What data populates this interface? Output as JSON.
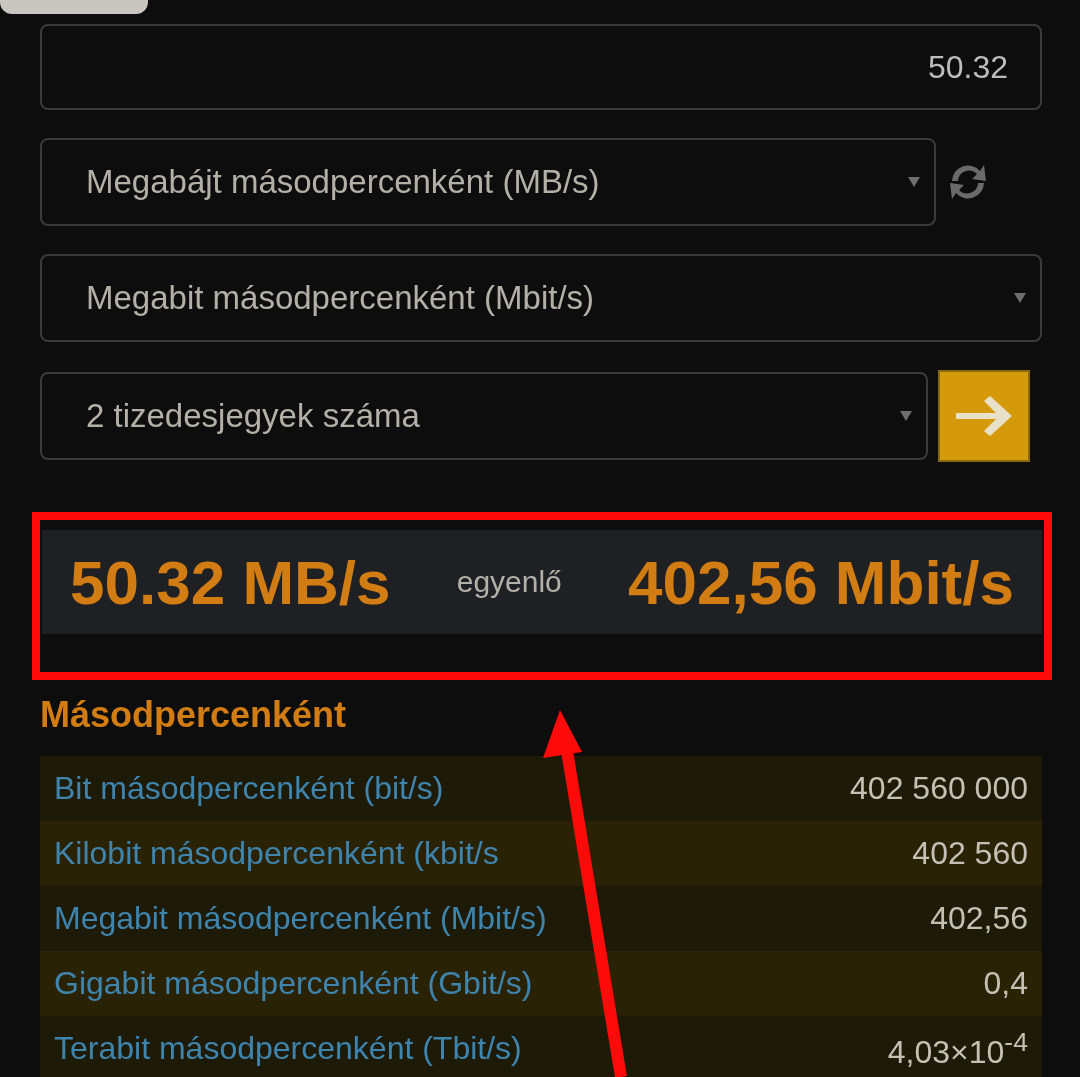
{
  "amount": {
    "value": "50.32"
  },
  "from_unit": {
    "value": "Megabájt másodpercenként (MB/s)"
  },
  "to_unit": {
    "value": "Megabit másodpercenként (Mbit/s)"
  },
  "decimals": {
    "value": "2 tizedesjegyek száma"
  },
  "result": {
    "from": "50.32 MB/s",
    "equals": "egyenlő",
    "to": "402,56 Mbit/s"
  },
  "section_title": "Másodpercenként",
  "rows": [
    {
      "unit": "Bit másodpercenként (bit/s)",
      "value": "402 560 000"
    },
    {
      "unit": "Kilobit másodpercenként (kbit/s",
      "value": "402 560"
    },
    {
      "unit": "Megabit másodpercenként (Mbit/s)",
      "value": "402,56"
    },
    {
      "unit": "Gigabit másodpercenként (Gbit/s)",
      "value": "0,4"
    },
    {
      "unit": "Terabit másodpercenként (Tbit/s)",
      "value": "4,03×10$^{-4}$"
    }
  ]
}
